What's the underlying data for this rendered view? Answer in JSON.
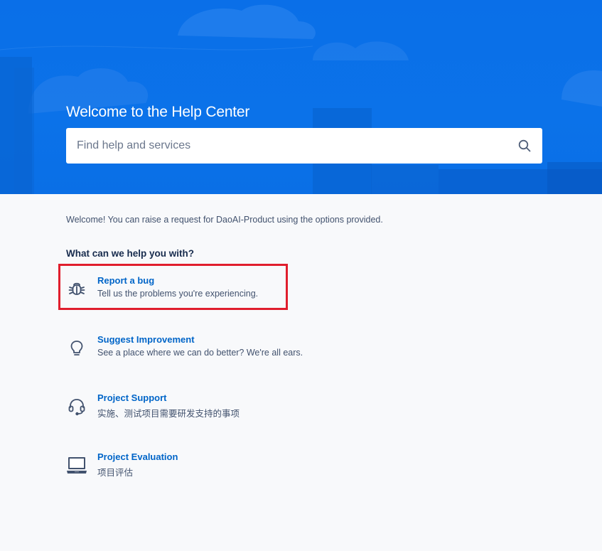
{
  "hero": {
    "title": "Welcome to the Help Center",
    "background_color": "#0b72e9"
  },
  "search": {
    "placeholder": "Find help and services",
    "value": "",
    "icon": "search-icon"
  },
  "intro_text": "Welcome! You can raise a request for DaoAI-Product using the options provided.",
  "section_heading": "What can we help you with?",
  "options": [
    {
      "title": "Report a bug",
      "description": "Tell us the problems you're experiencing.",
      "icon": "bug-icon",
      "highlighted": true
    },
    {
      "title": "Suggest Improvement",
      "description": "See a place where we can do better? We're all ears.",
      "icon": "lightbulb-icon",
      "highlighted": false
    },
    {
      "title": "Project Support",
      "description": "实施、测试项目需要研发支持的事项",
      "icon": "headset-icon",
      "highlighted": false
    },
    {
      "title": "Project Evaluation",
      "description": "项目评估",
      "icon": "laptop-icon",
      "highlighted": false
    }
  ],
  "colors": {
    "link": "#0065c8",
    "text": "#172b4d",
    "muted": "#42526e",
    "highlight": "#e01e2d",
    "page_background": "#f8f9fb"
  }
}
